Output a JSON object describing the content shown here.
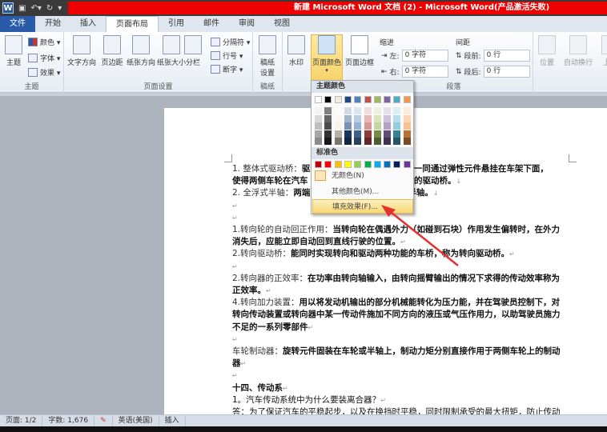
{
  "window": {
    "title": "新建 Microsoft Word 文档 (2) - Microsoft Word(产品激活失败)",
    "app_icon": "W"
  },
  "tabs": [
    "文件",
    "开始",
    "插入",
    "页面布局",
    "引用",
    "邮件",
    "审阅",
    "视图"
  ],
  "ribbon": {
    "theme_group": {
      "label": "主题",
      "theme": "主题",
      "colors": "颜色 ▾",
      "fonts": "字体 ▾",
      "effects": "效果 ▾"
    },
    "page_setup": {
      "label": "页面设置",
      "text_direction": "文字方向",
      "margins": "页边距",
      "orientation": "纸张方向",
      "size": "纸张大小",
      "columns": "分栏",
      "breaks": "分隔符 ▾",
      "line_numbers": "行号 ▾",
      "hyphenation": "断字 ▾"
    },
    "draft": {
      "label": "稿纸",
      "settings": "稿纸设置"
    },
    "background": {
      "watermark": "水印",
      "page_color": "页面颜色",
      "page_borders": "页面边框"
    },
    "paragraph": {
      "label": "段落",
      "indent": "缩进",
      "left_label": "左:",
      "left_value": "0 字符",
      "right_label": "右:",
      "right_value": "0 字符",
      "spacing": "间距",
      "before_label": "段前:",
      "before_value": "0 行",
      "after_label": "段后:",
      "after_value": "0 行"
    },
    "arrange": {
      "position": "位置",
      "wrap": "自动换行",
      "bring_forward": "上移"
    }
  },
  "dropdown": {
    "theme_colors_label": "主题颜色",
    "theme_colors": [
      "#ffffff",
      "#000000",
      "#eeece1",
      "#1f497d",
      "#4f81bd",
      "#c0504d",
      "#9bbb59",
      "#8064a2",
      "#4bacc6",
      "#f79646"
    ],
    "standard_colors_label": "标准色",
    "standard_colors": [
      "#c00000",
      "#ff0000",
      "#ffc000",
      "#ffff00",
      "#92d050",
      "#00b050",
      "#00b0f0",
      "#0070c0",
      "#002060",
      "#7030a0"
    ],
    "no_color": "无颜色(N)",
    "more_colors": "其他颜色(M)...",
    "fill_effects": "填充效果(F)..."
  },
  "document": {
    "l1a": "1. 整体式驱动桥：",
    "l1b": "驱动",
    "l1c": "车轮一同通过弹性元件悬挂在车架下面，",
    "l2a": "使得两侧车轮在汽车",
    "l2b": "动的驱动桥。",
    "l3a": "2. 全浮式半轴：",
    "l3b": "两端",
    "l3c": "半轴。",
    "l4a": "1.转向轮的自动回正作用：",
    "l4b": "当转向轮在偶遇外力（如碰到石块）作用发生偏转时，在外力",
    "l5": "消失后，应能立即自动回到直线行驶的位置。",
    "l6a": "2.转向驱动桥：",
    "l6b": "能同时实现转向和驱动两种功能的车桥，称为转向驱动桥。",
    "l7a": "2.转向器的正效率：",
    "l7b": "在功率由转向轴输入，由转向摇臂输出的情况下求得的传动效率称为",
    "l8": "正效率。",
    "l9a": "4.转向加力装置：",
    "l9b": "用以将发动机输出的部分机械能转化为压力能，并在驾驶员控制下，对",
    "l10": "转向传动装置或转向器中某一传动件施加不同方向的液压或气压作用力，以助驾驶员施力",
    "l11": "不足的一系列零部件",
    "l12a": "车轮制动器：",
    "l12b": "旋转元件固装在车轮或半轴上，制动力矩分别直接作用于两侧车轮上的制动",
    "l13": "器",
    "l14": "十四、传动系",
    "l15": "1。汽车传动系统中为什么要装离合器？",
    "l16": "答：为了保证汽车的平稳起步，以及在换挡时平稳，同时限制承受的最大扭矩，防止传动系"
  },
  "status": {
    "page": "页面: 1/2",
    "words": "字数: 1,676",
    "language": "英语(美国)",
    "mode": "插入"
  },
  "annotation_color": "#e53030"
}
